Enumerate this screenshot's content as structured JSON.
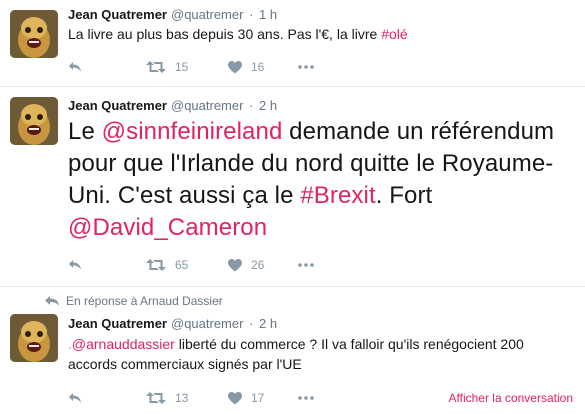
{
  "colors": {
    "accent": "#e0245e",
    "muted": "#657786",
    "icon": "#8899a6"
  },
  "tweets": [
    {
      "author": {
        "name": "Jean Quatremer",
        "handle": "@quatremer"
      },
      "separator": "·",
      "time": "1 h",
      "text_before": "La livre au plus bas depuis 30 ans. Pas l'€, la livre ",
      "hashtag": "#olé",
      "retweets": "15",
      "likes": "16"
    },
    {
      "author": {
        "name": "Jean Quatremer",
        "handle": "@quatremer"
      },
      "separator": "·",
      "time": "2 h",
      "text": {
        "p1": "Le ",
        "mention1": "@sinnfeinireland",
        "p2": " demande un référendum pour que l'Irlande du nord quitte le Royaume-Uni. C'est aussi ça le ",
        "hashtag": "#Brexit",
        "p3": ". Fort ",
        "mention2": "@David_Cameron"
      },
      "retweets": "65",
      "likes": "26"
    },
    {
      "context": "En réponse à Arnaud Dassier",
      "author": {
        "name": "Jean Quatremer",
        "handle": "@quatremer"
      },
      "separator": "·",
      "time": "2 h",
      "text": {
        "dot": ".",
        "mention": "@arnauddassier",
        "rest": " liberté du commerce ? Il va falloir qu'ils renégocient 200 accords commerciaux signés par l'UE"
      },
      "retweets": "13",
      "likes": "17",
      "show_conversation": "Afficher la conversation"
    }
  ],
  "icons": [
    "reply-icon",
    "retweet-icon",
    "heart-icon",
    "more-icon",
    "reply-context-icon"
  ]
}
